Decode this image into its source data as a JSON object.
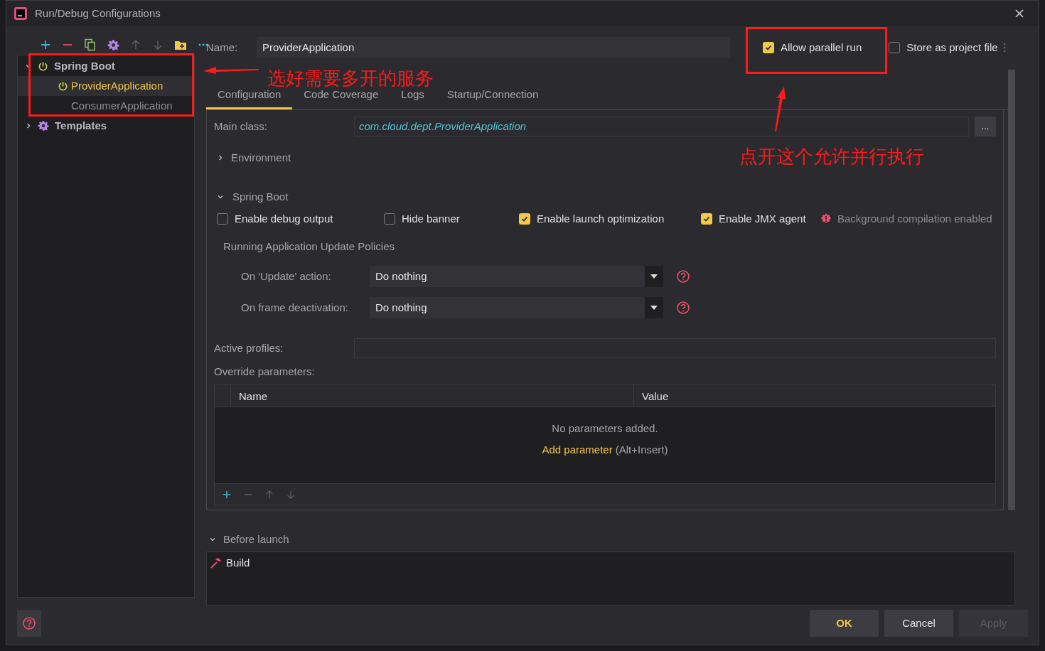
{
  "window": {
    "title": "Run/Debug Configurations"
  },
  "tree": [
    {
      "label": "Spring Boot",
      "kind": "spring-boot",
      "expanded": true,
      "children": [
        {
          "label": "ProviderApplication",
          "kind": "app",
          "selected": true
        },
        {
          "label": "ConsumerApplication",
          "kind": "plain",
          "selected": false
        }
      ]
    },
    {
      "label": "Templates",
      "kind": "templates",
      "expanded": false
    }
  ],
  "name_field": {
    "label": "Name:",
    "value": "ProviderApplication"
  },
  "header_options": [
    {
      "label": "Allow parallel run",
      "checked": true
    },
    {
      "label": "Store as project file",
      "checked": false
    }
  ],
  "tabs": [
    {
      "label": "Configuration",
      "selected": true
    },
    {
      "label": "Code Coverage",
      "selected": false
    },
    {
      "label": "Logs",
      "selected": false
    },
    {
      "label": "Startup/Connection",
      "selected": false
    }
  ],
  "main_class": {
    "label": "Main class:",
    "value": "com.cloud.dept.ProviderApplication",
    "button": "..."
  },
  "environment": {
    "label": "Environment",
    "expanded": false
  },
  "spring_boot": {
    "label": "Spring Boot",
    "expanded": true,
    "options": [
      {
        "label": "Enable debug output",
        "checked": false
      },
      {
        "label": "Hide banner",
        "checked": false
      },
      {
        "label": "Enable launch optimization",
        "checked": true
      },
      {
        "label": "Enable JMX agent",
        "checked": true
      }
    ],
    "warning": "Background compilation enabled"
  },
  "policies": {
    "title": "Running Application Update Policies",
    "rows": [
      {
        "label": "On 'Update' action:",
        "value": "Do nothing"
      },
      {
        "label": "On frame deactivation:",
        "value": "Do nothing"
      }
    ]
  },
  "active_profiles": {
    "label": "Active profiles:"
  },
  "override": {
    "label": "Override parameters:",
    "columns": [
      "Name",
      "Value"
    ],
    "empty": "No parameters added.",
    "link": "Add parameter",
    "hint": "(Alt+Insert)"
  },
  "before_launch": {
    "label": "Before launch",
    "expanded": true,
    "tasks": [
      "Build"
    ]
  },
  "buttons": [
    {
      "label": "OK",
      "kind": "default",
      "disabled": false
    },
    {
      "label": "Cancel",
      "kind": "normal",
      "disabled": false
    },
    {
      "label": "Apply",
      "kind": "normal",
      "disabled": true
    }
  ],
  "annotations": [
    {
      "text": "选好需要多开的服务"
    },
    {
      "text": "点开这个允许并行执行"
    }
  ]
}
